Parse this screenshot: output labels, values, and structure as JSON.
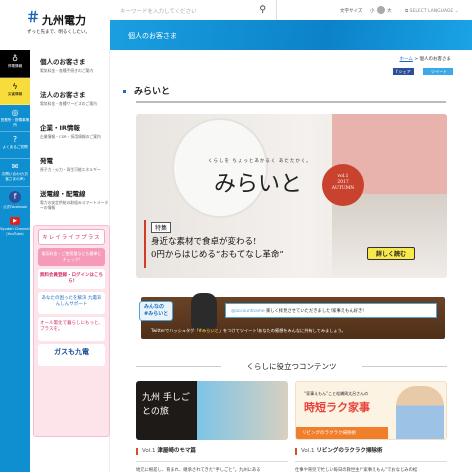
{
  "logo": {
    "name": "九州電力",
    "tagline": "ずっと先まで、明るくしたい。"
  },
  "search": {
    "placeholder": "キーワードを入力してください"
  },
  "tools": {
    "font_size_label": "文字サイズ",
    "small": "小",
    "large": "大",
    "language": "SELECT LANGUAGE"
  },
  "banner": {
    "title": "個人のお客さま"
  },
  "strip": [
    {
      "label": "停電情報",
      "icon": "lightbulb-icon",
      "bg": "#000000"
    },
    {
      "label": "災害情報",
      "icon": "lightning-icon",
      "bg": "#f7dc3b"
    },
    {
      "label": "営業所・配電事業所",
      "icon": "location-pin-icon"
    },
    {
      "label": "よくあるご質問",
      "icon": "question-icon"
    },
    {
      "label": "お問い合わせ(お客さまの声)",
      "icon": "mail-icon"
    },
    {
      "label": "公式Facebook",
      "icon": "facebook-icon"
    },
    {
      "label": "Kyuden Channel (YouTube)",
      "icon": "youtube-icon"
    }
  ],
  "nav": [
    {
      "title": "個人のお客さま",
      "desc": "電気料金・各種手続きのご案内"
    },
    {
      "title": "法人のお客さま",
      "desc": "電気料金・各種サービスのご案内"
    },
    {
      "title": "企業・IR情報",
      "desc": "企業情報・CSR・採用情報のご案内"
    },
    {
      "title": "発電",
      "desc": "原子力・火力・再生可能エネルギー"
    },
    {
      "title": "送電線・配電線",
      "desc": "電力の安定供給の取組みスマートメーターの情報"
    }
  ],
  "promo": {
    "title": "キレイライフプラス",
    "check": "電気料金・ご使用量なども簡単にチェック!",
    "register": "無料会員登録・ログインはこちら!",
    "support": "あなたの困ったを解決 九電あんしんサポート",
    "allelec": "オール電化で暮らしにもっと、プラスを。",
    "gas": "ガスも九電"
  },
  "breadcrumb": {
    "home": "ホーム",
    "sep": ">",
    "current": "個人のお客さま"
  },
  "share": {
    "facebook": "f シェア",
    "twitter": "ツイート"
  },
  "page_title": "みらいと",
  "hero": {
    "sub": "くらしを ちょっとあかるく あたたかく。",
    "logo": "みらいと",
    "vol": "vol.1",
    "year": "2017",
    "season": "AUTUMN",
    "tag": "特集",
    "line1": "身近な素材で食卓が変わる!",
    "line2": "0円からはじめる“おもてなし革命”",
    "more": "詳しく読む"
  },
  "twitter": {
    "tag_top": "みんなの",
    "tag": "#みらいと",
    "account": "@accountname",
    "tweet": "楽しく拝見させていただきました!家事えもん好き!",
    "bottom_pre": "Twitterでハッシュタグ「",
    "bottom_tag": "#みらいと",
    "bottom_post": "」をつけてツイート!あなたの感想をみんなに共有してみましょう。"
  },
  "section_title": "くらしに役立つコンテンツ",
  "cards": [
    {
      "vol": "Vol.1",
      "title": "津屋崎のモマ篇",
      "img_title": "九州 手しごとの旅",
      "text": "地元に根差し、育まれ、継承されてきた“手しごと”。九州にある"
    },
    {
      "vol": "Vol.1",
      "title": "リビングのラクラク掃除術",
      "img_title": "時短ラク家事",
      "img_sub": "“家事えもん”こと松橋周太呂さんの",
      "img_band": "リビングのラクラク掃除術",
      "text": "仕事や育児で忙しい毎日の救世主!“家事えもん”でおなじみの松"
    }
  ]
}
